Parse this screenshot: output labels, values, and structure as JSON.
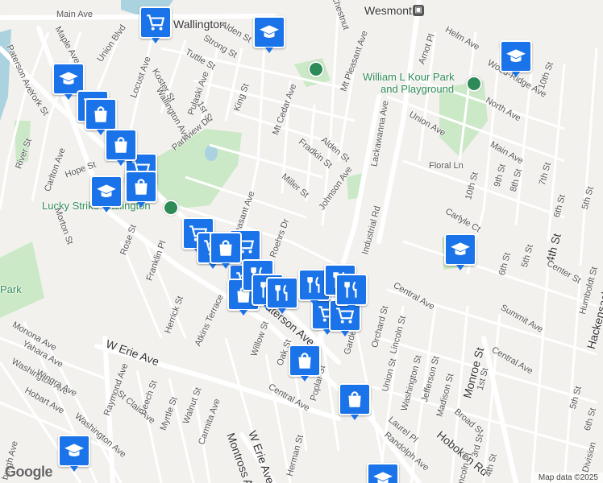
{
  "map": {
    "logo": "Google",
    "attribution": "Map data ©2025",
    "colors": {
      "land": "#f3f1ee",
      "road": "#ffffff",
      "park": "#cbe9c6",
      "water": "#aad3df",
      "pin": "#1a73e8",
      "poi": "#2e8b57"
    }
  },
  "labels": {
    "wallington": "Wallington",
    "wesmont": "Wesmont",
    "kour_park": "William L Kour Park",
    "kour_park2": "and Playground",
    "lucky_strike": "Lucky Strike Wallington",
    "park": "Park",
    "main_ave_top": "Main Ave",
    "main_ave_right": "Main Ave",
    "maple_ave": "Maple Ave",
    "union_blvd": "Union Blvd",
    "paterson_ave_left": "Paterson Ave",
    "york_st": "York St",
    "river_st": "River St",
    "carlton_ave": "Carlton Ave",
    "hope_st": "Hope St",
    "locust_ave": "Locust Ave",
    "koster_st": "Koster St",
    "wallington_ave": "Wallington Ave",
    "pulaski_ave": "Pulaski Ave",
    "tuttle_st": "Tuttle St",
    "strong_st": "Strong St",
    "alden_st_top": "Alden St",
    "first_st": "1st St",
    "king_st": "King St",
    "parkview_dr": "Parkview Dr",
    "mt_cedar_ave": "Mt Cedar Ave",
    "mt_pleasant_ave": "Mt Pleasant Ave",
    "chestnut": "Chestnut",
    "alden_st": "Alden St",
    "fradkin_st": "Fradkin St",
    "miller_st": "Miller St",
    "johnson_ave": "Johnson Ave",
    "lackawanna_ave": "Lackawanna Ave",
    "union_ave": "Union Ave",
    "floral_ln": "Floral Ln",
    "helm_ave": "Helm Ave",
    "arnot_pl": "Arnot Pl",
    "north_ave": "North Ave",
    "wood_ridge_ave": "Wood-Ridge Ave",
    "tenth_st_top": "10th St",
    "main_ave_e": "Main Ave",
    "tenth_st": "10th St",
    "ninth_st": "9th St",
    "eighth_st": "8th St",
    "seventh_st": "7th St",
    "sixth_st": "6th St",
    "fifth_st": "5th St",
    "carlyle_ct": "Carlyle Ct",
    "industrial_rd": "Industrial Rd",
    "rose_st": "Rose St",
    "morton_st": "Morton St",
    "franklin_pl": "Franklin Pl",
    "roehrs_dr": "Roehrs Dr",
    "pleasant_ave": "Pleasant Ave",
    "herrick_st": "Herrick St",
    "atkins_terrace": "Atkins Terrace",
    "paterson_ave": "Paterson Ave",
    "willow_st": "Willow St",
    "oak_st": "Oak St",
    "garden_st": "Garden St",
    "orchard_st": "Orchard St",
    "lincoln_st": "Lincoln St",
    "central_ave_mid": "Central Ave",
    "sixth_st_b": "6th St",
    "fifth_st_b": "5th St",
    "fourth_st": "4th St",
    "center_st": "Center St",
    "humboldt_st": "Humboldt St",
    "hackensack_st": "Hackensack St",
    "summit_ave": "Summit Ave",
    "monroe_st": "Monroe St",
    "central_ave_r": "Central Ave",
    "first_st_b": "1st St",
    "monona_ave": "Monona Ave",
    "yahara_ave": "Yahara Ave",
    "washington_ave_l": "Washington Ave",
    "wingra_ave": "Wingra Ave",
    "hobart_ave": "Hobart Ave",
    "w_erie_ave": "W Erie Ave",
    "raymond_ave": "Raymond Ave",
    "st_clair_ave": "St Clair Ave",
    "beech_st": "Beech St",
    "myrtle_st": "Myrtle St",
    "walnut_st": "Walnut St",
    "carmita_ave": "Carmita Ave",
    "washington_ave_b": "Washington Ave",
    "central_ave_b": "Central Ave",
    "poplar_st": "Poplar St",
    "union_st": "Union St",
    "washington_st": "Washington St",
    "jefferson_st": "Jefferson St",
    "madison_st": "Madison St",
    "laurel_pl": "Laurel Pl",
    "randolph_ave": "Randolph Ave",
    "broad_st": "Broad St",
    "hoboken_rd": "Hoboken Rd",
    "third_st": "3rd St",
    "fourth_st_b": "4th St",
    "lincoln_pl": "Lincoln Pl",
    "herman_st": "Herman St",
    "w_erie_ave_b": "W Erie Ave",
    "montross_ave": "Montross Ave",
    "fifth_st_c": "5th St",
    "division": "Division",
    "sixth_st_c": "6th St",
    "burgh_ave": "burgh Ave"
  }
}
